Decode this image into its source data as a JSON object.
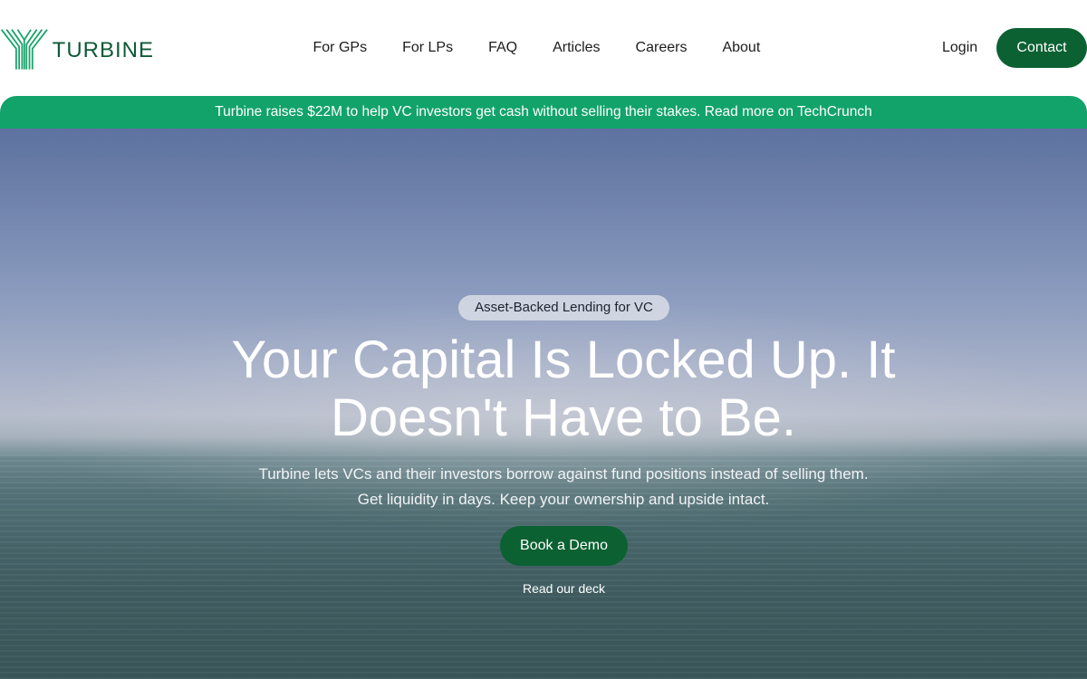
{
  "brand": {
    "name": "TURBINE",
    "accent": "#0b6132",
    "banner_color": "#12a36a"
  },
  "nav": {
    "links": [
      "For GPs",
      "For LPs",
      "FAQ",
      "Articles",
      "Careers",
      "About"
    ],
    "login": "Login",
    "contact": "Contact"
  },
  "banner": {
    "text": "Turbine raises $22M to help VC investors get cash without selling their stakes. Read more on TechCrunch"
  },
  "hero": {
    "tag": "Asset-Backed Lending for VC",
    "headline": "Your Capital Is Locked Up. It Doesn't Have to Be.",
    "sub_line1": "Turbine lets VCs and their investors borrow against fund positions instead of selling them.",
    "sub_line2": "Get liquidity in days. Keep your ownership and upside intact.",
    "cta": "Book a Demo",
    "secondary_link": "Read our deck"
  }
}
